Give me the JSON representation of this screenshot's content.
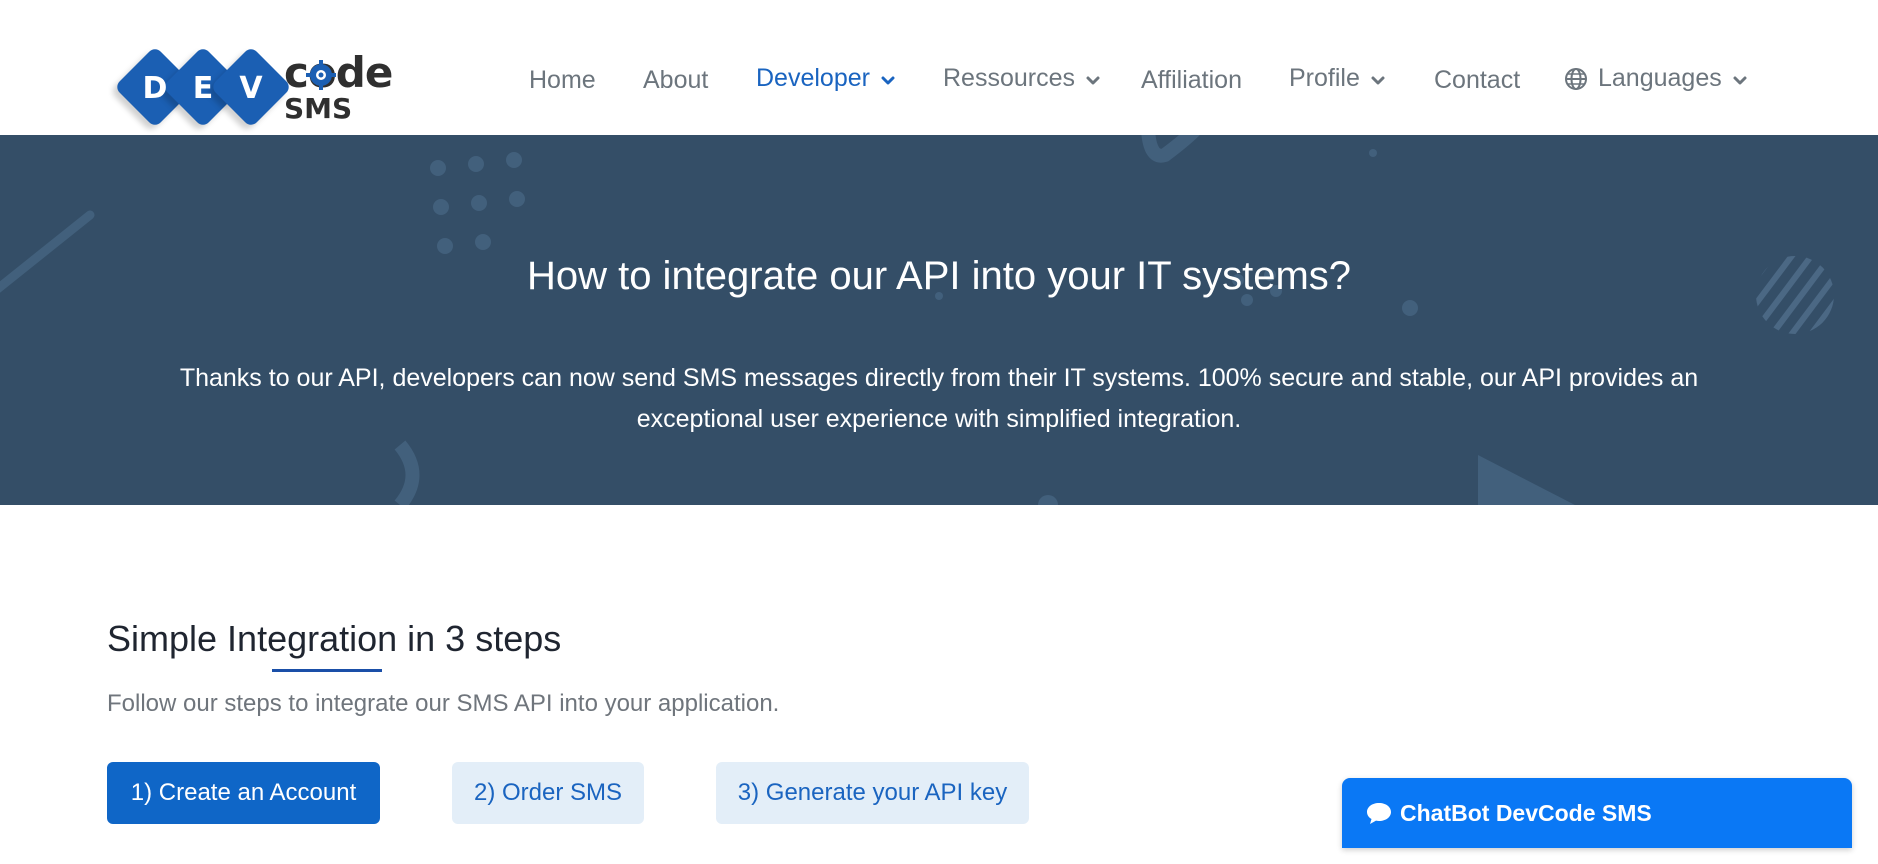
{
  "brand": {
    "letters": [
      "D",
      "E",
      "V"
    ],
    "word_top": "code",
    "word_bottom": "SMS",
    "primary_color": "#1b5fb3"
  },
  "nav": {
    "items": [
      {
        "label": "Home",
        "dropdown": false,
        "active": false
      },
      {
        "label": "About",
        "dropdown": false,
        "active": false
      },
      {
        "label": "Developer",
        "dropdown": true,
        "active": true
      },
      {
        "label": "Ressources",
        "dropdown": true,
        "active": false
      },
      {
        "label": "Affiliation",
        "dropdown": false,
        "active": false
      },
      {
        "label": "Profile",
        "dropdown": true,
        "active": false
      },
      {
        "label": "Contact",
        "dropdown": false,
        "active": false
      },
      {
        "label": "Languages",
        "dropdown": true,
        "active": false,
        "icon": "globe-icon"
      }
    ],
    "active_color": "#1a64c0"
  },
  "hero": {
    "title": "How to integrate our API into your IT systems?",
    "text": "Thanks to our API, developers can now send SMS messages directly from their IT systems. 100% secure and stable, our API provides an exceptional user experience with simplified integration.",
    "background": "#344e67"
  },
  "steps": {
    "title": "Simple Integration in 3 steps",
    "subtitle": "Follow our steps to integrate our SMS API into your application.",
    "buttons": [
      {
        "label": "1) Create an Account"
      },
      {
        "label": "2) Order SMS"
      },
      {
        "label": "3) Generate your API key"
      }
    ]
  },
  "chatbot": {
    "label": "ChatBot DevCode SMS",
    "icon": "chat-bubble-icon",
    "color": "#0a78f5"
  }
}
